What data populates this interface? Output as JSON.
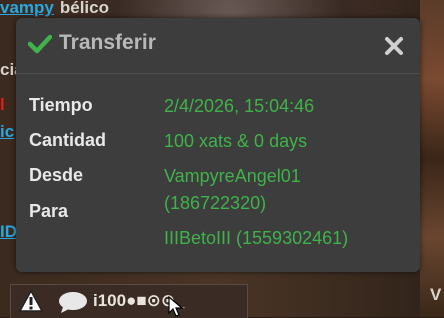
{
  "chat": {
    "username": "vampy",
    "user_text": "bélico",
    "frag1": "cia",
    "frag2": "l",
    "frag3": "ic",
    "frag4": "ID"
  },
  "right_letter": "V",
  "toolbar": {
    "status_text": "i100●■⊙⊙_"
  },
  "dialog": {
    "title": "Transferir",
    "labels": {
      "time": "Tiempo",
      "amount": "Cantidad",
      "from": "Desde",
      "to": "Para"
    },
    "values": {
      "time": "2/4/2026, 15:04:46",
      "amount": "100 xats & 0 days",
      "from_line1": "VampyreAngel01",
      "from_line2": "(186722320)",
      "to": "IIIBetoIII (1559302461)"
    }
  },
  "colors": {
    "accent_green": "#3fb24a",
    "dialog_bg": "#3d3d3d",
    "link_blue": "#29a8e0"
  }
}
